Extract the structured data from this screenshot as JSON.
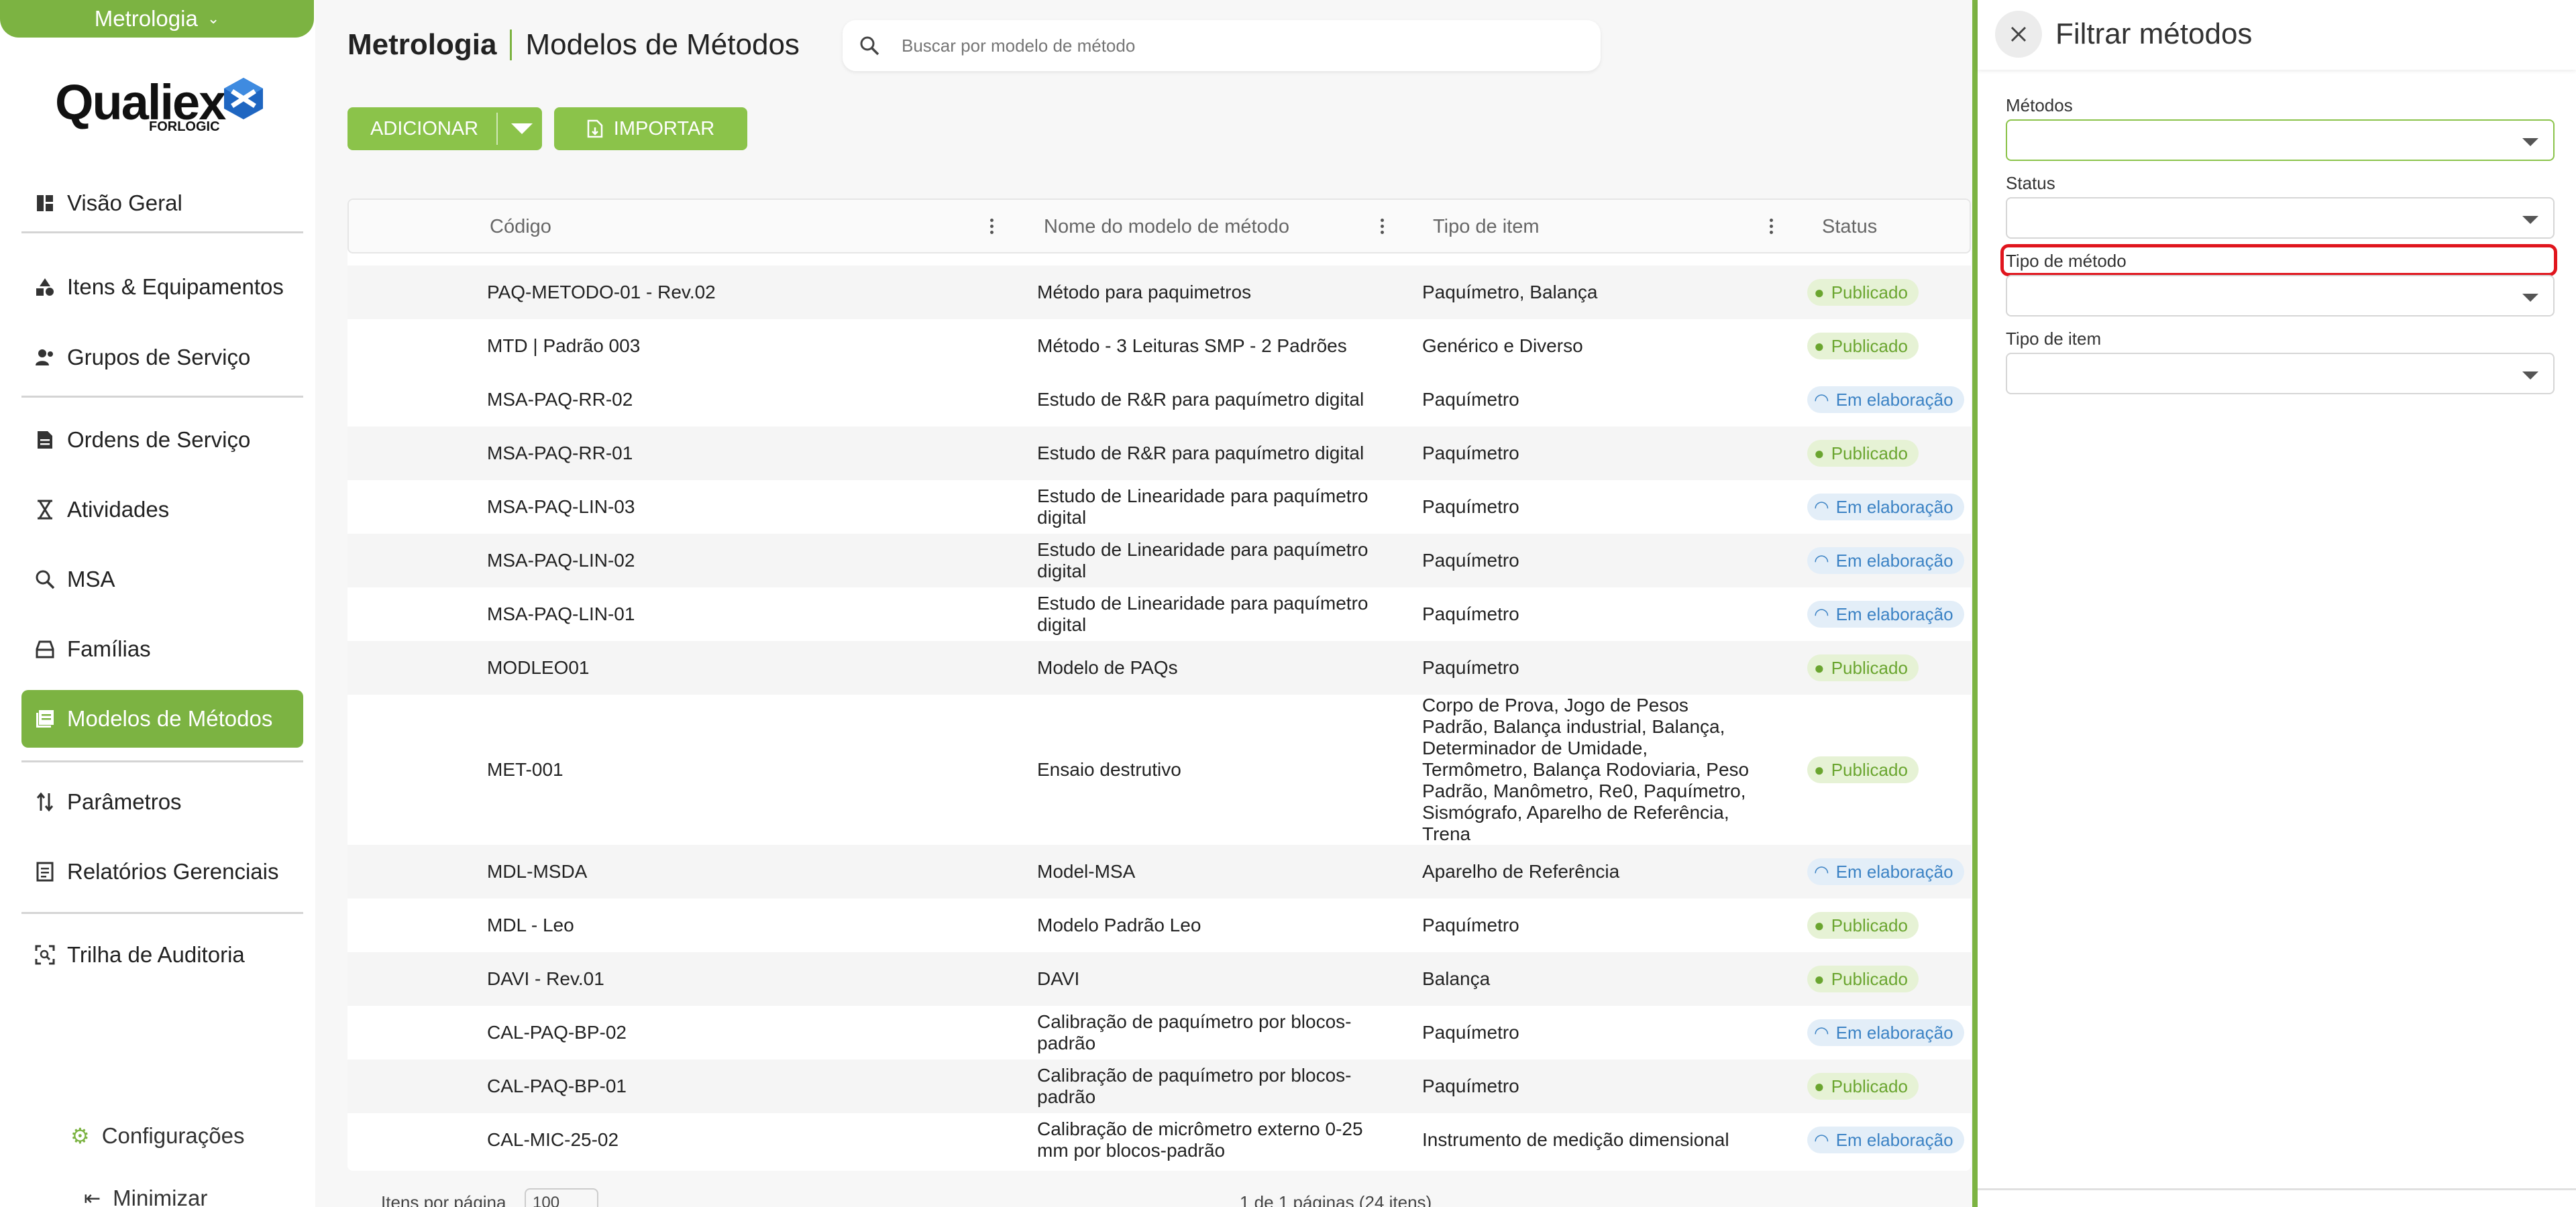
{
  "sidebar": {
    "module_label": "Metrologia",
    "logo_text": "Qualiex",
    "logo_sub": "FORLOGIC",
    "items": [
      {
        "label": "Visão Geral",
        "icon": "dashboard-icon"
      },
      {
        "label": "Itens & Equipamentos",
        "icon": "shapes-icon"
      },
      {
        "label": "Grupos de Serviço",
        "icon": "group-icon"
      },
      {
        "label": "Ordens de Serviço",
        "icon": "document-icon"
      },
      {
        "label": "Atividades",
        "icon": "hourglass-icon"
      },
      {
        "label": "MSA",
        "icon": "magnify-icon"
      },
      {
        "label": "Famílias",
        "icon": "tray-icon"
      },
      {
        "label": "Modelos de Métodos",
        "icon": "template-icon"
      },
      {
        "label": "Parâmetros",
        "icon": "sort-icon"
      },
      {
        "label": "Relatórios Gerenciais",
        "icon": "report-icon"
      },
      {
        "label": "Trilha de Auditoria",
        "icon": "audit-icon"
      }
    ],
    "settings_label": "Configurações",
    "minimize_label": "Minimizar"
  },
  "header": {
    "module": "Metrologia",
    "page": "Modelos de Métodos",
    "search_placeholder": "Buscar por modelo de método"
  },
  "toolbar": {
    "add_label": "ADICIONAR",
    "import_label": "IMPORTAR"
  },
  "table": {
    "columns": [
      "Código",
      "Nome do modelo de método",
      "Tipo de item",
      "Status"
    ],
    "rows": [
      {
        "code": "PAQ-METODO-01 - Rev.02",
        "name": "Método para paquimetros",
        "type": "Paquímetro, Balança",
        "status": "Publicado"
      },
      {
        "code": "MTD | Padrão 003",
        "name": "Método - 3 Leituras SMP - 2 Padrões",
        "type": "Genérico e Diverso",
        "status": "Publicado"
      },
      {
        "code": "MSA-PAQ-RR-02",
        "name": "Estudo de R&R para paquímetro digital",
        "type": "Paquímetro",
        "status": "Em elaboração"
      },
      {
        "code": "MSA-PAQ-RR-01",
        "name": "Estudo de R&R para paquímetro digital",
        "type": "Paquímetro",
        "status": "Publicado"
      },
      {
        "code": "MSA-PAQ-LIN-03",
        "name": "Estudo de Linearidade para paquímetro digital",
        "type": "Paquímetro",
        "status": "Em elaboração"
      },
      {
        "code": "MSA-PAQ-LIN-02",
        "name": "Estudo de Linearidade para paquímetro digital",
        "type": "Paquímetro",
        "status": "Em elaboração"
      },
      {
        "code": "MSA-PAQ-LIN-01",
        "name": "Estudo de Linearidade para paquímetro digital",
        "type": "Paquímetro",
        "status": "Em elaboração"
      },
      {
        "code": "MODLEO01",
        "name": "Modelo de PAQs",
        "type": "Paquímetro",
        "status": "Publicado"
      },
      {
        "code": "MET-001",
        "name": "Ensaio destrutivo",
        "type": "Corpo de Prova, Jogo de Pesos Padrão, Balança industrial, Balança, Determinador de Umidade, Termômetro, Balança Rodoviaria, Peso Padrão, Manômetro, Re0, Paquímetro, Sismógrafo, Aparelho de Referência, Trena",
        "status": "Publicado"
      },
      {
        "code": "MDL-MSDA",
        "name": "Model-MSA",
        "type": "Aparelho de Referência",
        "status": "Em elaboração"
      },
      {
        "code": "MDL - Leo",
        "name": "Modelo Padrão Leo",
        "type": "Paquímetro",
        "status": "Publicado"
      },
      {
        "code": "DAVI - Rev.01",
        "name": "DAVI",
        "type": "Balança",
        "status": "Publicado"
      },
      {
        "code": "CAL-PAQ-BP-02",
        "name": "Calibração de paquímetro por blocos-padrão",
        "type": "Paquímetro",
        "status": "Em elaboração"
      },
      {
        "code": "CAL-PAQ-BP-01",
        "name": "Calibração de paquímetro por blocos-padrão",
        "type": "Paquímetro",
        "status": "Publicado"
      },
      {
        "code": "CAL-MIC-25-02",
        "name": "Calibração de micrômetro externo 0-25 mm por blocos-padrão",
        "type": "Instrumento de medição dimensional",
        "status": "Em elaboração"
      }
    ]
  },
  "pagination": {
    "per_page_label": "Itens por página",
    "per_page_value": "100",
    "summary": "1 de 1 páginas (24 itens)"
  },
  "filter": {
    "title": "Filtrar métodos",
    "fields": [
      {
        "label": "Métodos",
        "value": ""
      },
      {
        "label": "Status",
        "value": ""
      },
      {
        "label": "Tipo de método",
        "value": ""
      },
      {
        "label": "Tipo de item",
        "value": ""
      }
    ]
  },
  "colors": {
    "accent": "#7cb342",
    "published_bg": "#e6f2d5",
    "published_fg": "#6aa52f",
    "draft_bg": "#e3eef8",
    "draft_fg": "#3b82c4",
    "highlight": "#e0151d"
  }
}
